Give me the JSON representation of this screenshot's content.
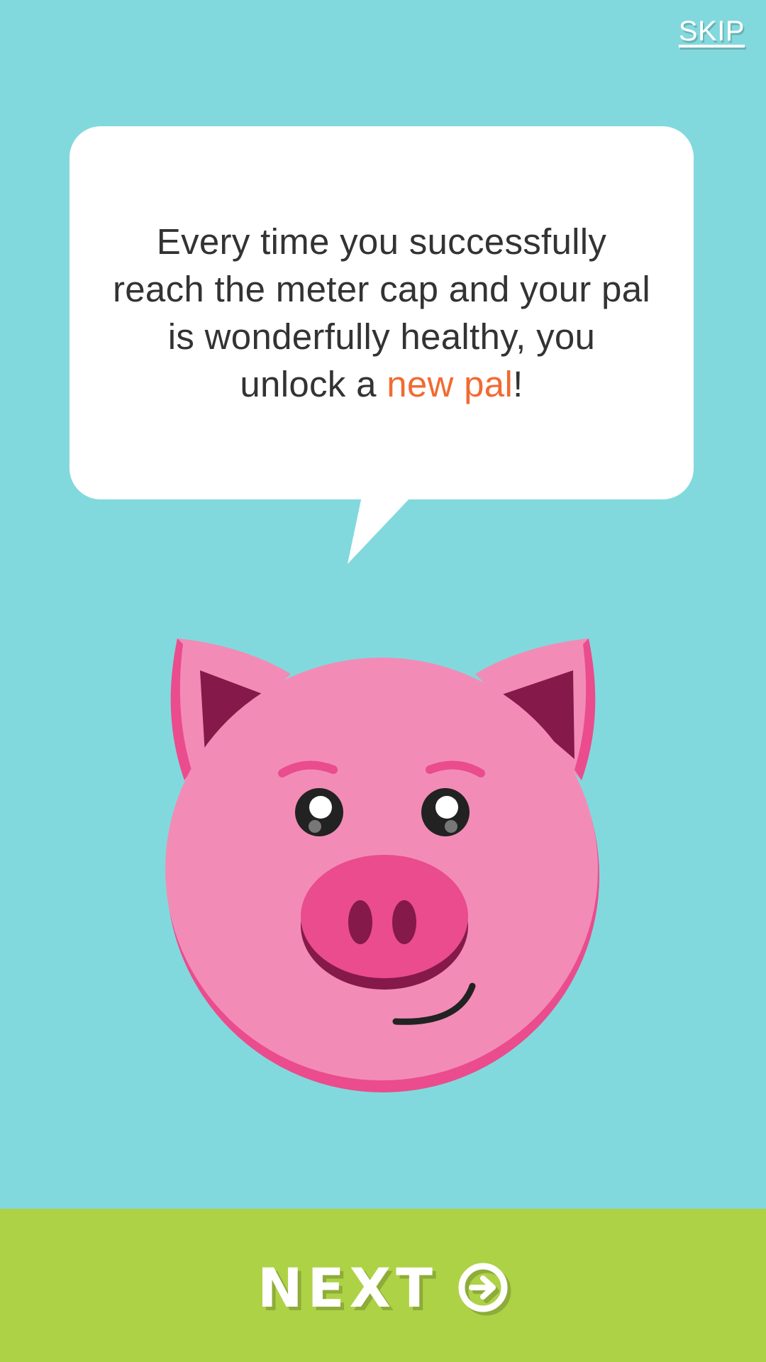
{
  "header": {
    "skip_label": "SKIP"
  },
  "bubble": {
    "text_before": "Every time you successfully reach the meter cap and your pal is wonderfully healthy, you unlock a ",
    "highlight": "new pal",
    "text_after": "!"
  },
  "footer": {
    "next_label": "NEXT",
    "next_icon": "arrow-circle-right-icon"
  },
  "colors": {
    "background": "#82D9DD",
    "bubble": "#FFFFFF",
    "highlight": "#F26A32",
    "next_bar": "#AED246",
    "pig_face": "#F28CB6",
    "pig_snout": "#EA4C8E"
  }
}
